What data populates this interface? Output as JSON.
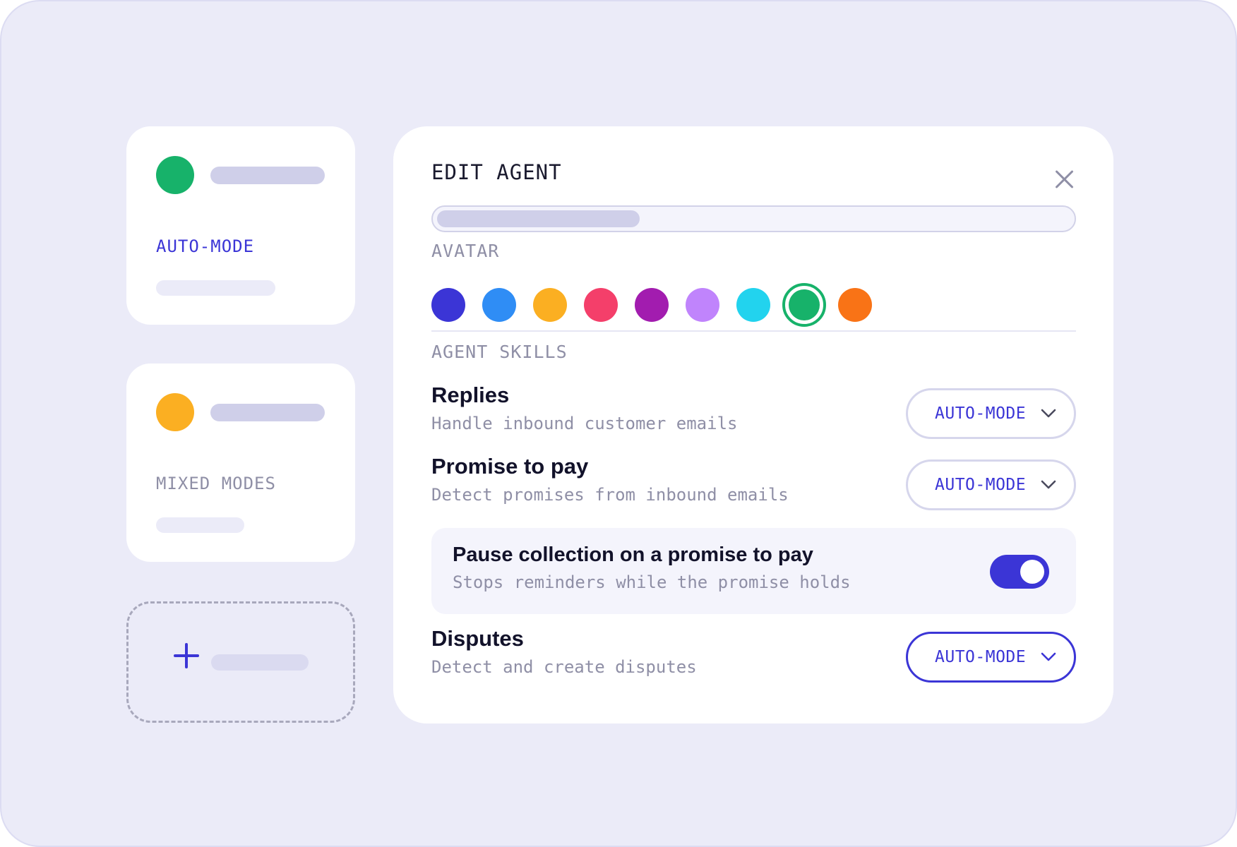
{
  "agents": [
    {
      "mode_label": "AUTO-MODE",
      "avatar_color": "#17b26a",
      "label_color": "#3b35d6"
    },
    {
      "mode_label": "MIXED MODES",
      "avatar_color": "#fbaf22",
      "label_color": "#8f8fa6"
    }
  ],
  "add_agent": {
    "icon": "plus-icon"
  },
  "edit_panel": {
    "title": "EDIT AGENT",
    "close_icon": "close-icon",
    "avatar_label": "AVATAR",
    "avatar_colors": [
      "#3b35d6",
      "#2f8df5",
      "#fbaf22",
      "#f43f6a",
      "#a21caf",
      "#c084fc",
      "#22d3ee",
      "#17b26a",
      "#f97316"
    ],
    "selected_avatar_color": "#17b26a",
    "skills_label": "AGENT SKILLS",
    "skills": [
      {
        "title": "Replies",
        "description": "Handle inbound customer emails",
        "mode": "AUTO-MODE"
      },
      {
        "title": "Promise to pay",
        "description": "Detect promises from inbound emails",
        "mode": "AUTO-MODE"
      },
      {
        "title": "Disputes",
        "description": "Detect and create disputes",
        "mode": "AUTO-MODE"
      }
    ],
    "pause_option": {
      "title": "Pause collection on a promise to pay",
      "description": "Stops reminders while the promise holds",
      "enabled": true
    }
  },
  "colors": {
    "accent": "#3b35d6",
    "background": "#ebebf8",
    "muted_text": "#8f8fa6"
  }
}
